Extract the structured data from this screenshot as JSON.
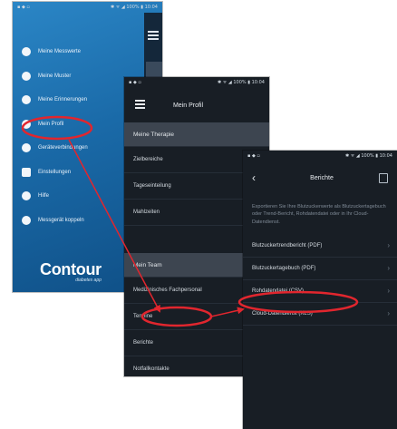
{
  "colors": {
    "accent_red": "#e1262e",
    "dark_bg": "#181e25",
    "blue_bg": "#1a6aa8"
  },
  "phone1": {
    "status_left": "▪ ◆ ▫",
    "status_right": "✱ ᯤ ◢ 100% ▮ 10:04",
    "menu": [
      {
        "label": "Meine Messwerte",
        "icon": "drop-icon"
      },
      {
        "label": "Meine Muster",
        "icon": "check-icon"
      },
      {
        "label": "Meine Erinnerungen",
        "icon": "bell-icon"
      },
      {
        "label": "Mein Profil",
        "icon": "profile-icon"
      },
      {
        "label": "Geräteverbindungen",
        "icon": "link-icon"
      },
      {
        "label": "Einstellungen",
        "icon": "gear-icon"
      },
      {
        "label": "Hilfe",
        "icon": "help-icon"
      },
      {
        "label": "Messgerät koppeln",
        "icon": "meter-icon"
      }
    ],
    "logo": {
      "main": "Contour",
      "sub": "diabetes app"
    }
  },
  "phone2": {
    "status_left": "▪ ◆ ▫",
    "status_right": "✱ ᯤ ◢ 100% ▮ 10:04",
    "title": "Mein Profil",
    "section1": "Meine Therapie",
    "rows1": [
      "Zielbereiche",
      "Tageseinteilung",
      "Mahlzeiten"
    ],
    "section2": "Mein Team",
    "rows2": [
      "Medizinisches Fachpersonal",
      "Termine",
      "Berichte",
      "Notfallkontakte"
    ]
  },
  "phone3": {
    "status_left": "▪ ◆ ▫",
    "status_right": "✱ ᯤ ◢ 100% ▮ 10:04",
    "title": "Berichte",
    "description": "Exportieren Sie Ihre Blutzuckerwerte als Blutzuckertagebuch oder Trend-Bericht, Rohdatendatei oder in Ihr Cloud-Datendienst.",
    "rows": [
      "Blutzuckertrendbericht (PDF)",
      "Blutzuckertagebuch (PDF)",
      "Rohdatendatei (CSV)",
      "Cloud-Datendienst (XLS)"
    ]
  }
}
